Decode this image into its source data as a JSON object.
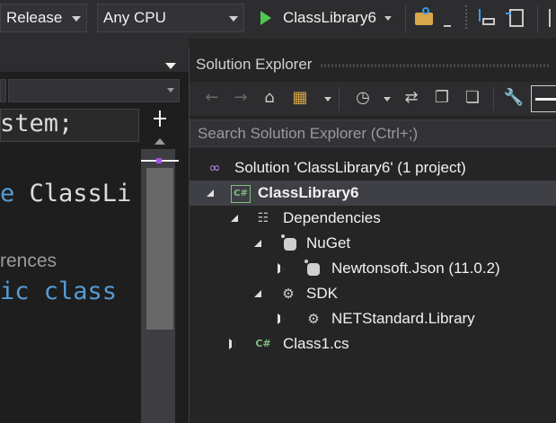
{
  "toolbar": {
    "configuration": "Release",
    "platform": "Any CPU",
    "run_target": "ClassLibrary6",
    "run_color": "#4ec94e"
  },
  "editor": {
    "lines": [
      {
        "text": "stem;",
        "color": "#dcdcdc"
      },
      {
        "text": "e ClassLi",
        "keyword": "e",
        "rest": " ClassLi"
      },
      {
        "text": "rences",
        "color": "#9b9b9b"
      },
      {
        "text": "ic class",
        "keyword_parts": [
          "ic class"
        ]
      }
    ]
  },
  "solution_explorer": {
    "title": "Solution Explorer",
    "search_placeholder": "Search Solution Explorer (Ctrl+;)",
    "tree": {
      "solution": "Solution 'ClassLibrary6' (1 project)",
      "project": "ClassLibrary6",
      "dependencies": "Dependencies",
      "nuget": "NuGet",
      "nuget_package": "Newtonsoft.Json (11.0.2)",
      "sdk": "SDK",
      "sdk_package": "NETStandard.Library",
      "file": "Class1.cs"
    }
  },
  "colors": {
    "keyword": "#569cd6",
    "csharp_icon": "#7ec07e",
    "solution_icon": "#b48be8",
    "selection": "#3f3f46"
  }
}
